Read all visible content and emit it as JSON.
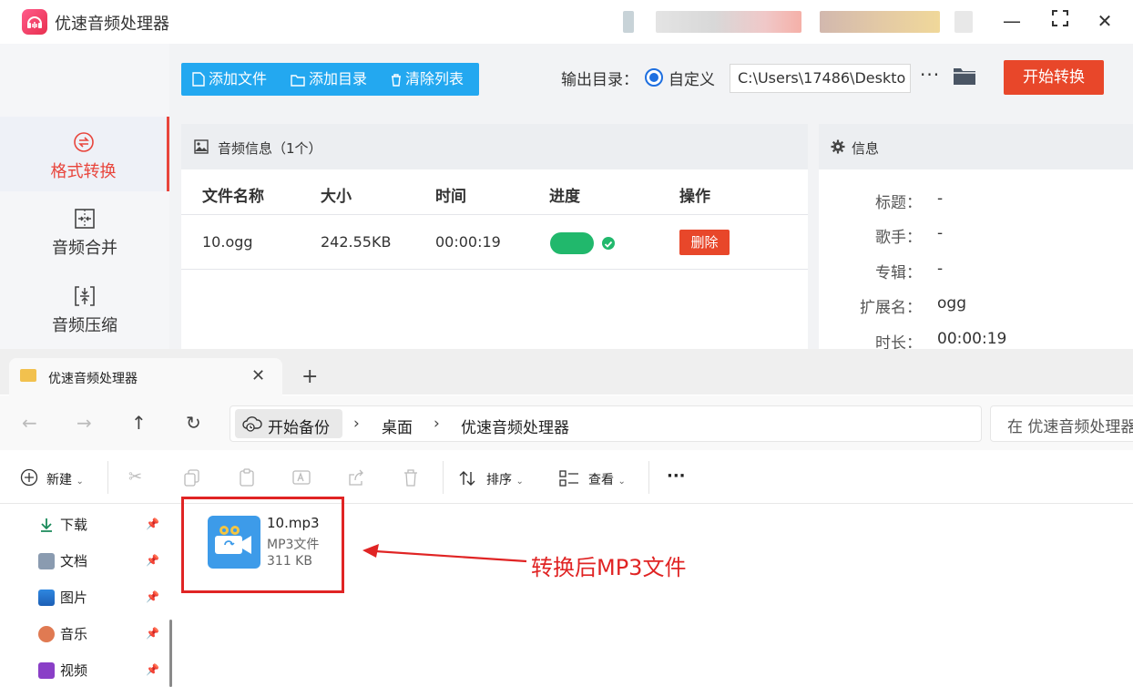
{
  "app": {
    "title": "优速音频处理器",
    "window_controls": {
      "minimize": "—",
      "maximize": "⛶",
      "close": "✕"
    }
  },
  "sidebar": {
    "items": [
      {
        "label": "格式转换",
        "icon": "convert-icon",
        "active": true
      },
      {
        "label": "音频合并",
        "icon": "merge-icon",
        "active": false
      },
      {
        "label": "音频压缩",
        "icon": "compress-icon",
        "active": false
      }
    ]
  },
  "toolbar": {
    "add_file": "添加文件",
    "add_dir": "添加目录",
    "clear_list": "清除列表",
    "output_label": "输出目录：",
    "radio_label": "自定义",
    "output_path": "C:\\Users\\17486\\Deskto",
    "more": "···",
    "start": "开始转换"
  },
  "file_panel": {
    "header": "音频信息（1个）",
    "columns": [
      "文件名称",
      "大小",
      "时间",
      "进度",
      "操作"
    ],
    "rows": [
      {
        "name": "10.ogg",
        "size": "242.55KB",
        "time": "00:00:19",
        "progress": 1.0,
        "action": "删除"
      }
    ]
  },
  "info_panel": {
    "header": "信息",
    "fields": [
      {
        "key": "标题：",
        "value": "-"
      },
      {
        "key": "歌手：",
        "value": "-"
      },
      {
        "key": "专辑：",
        "value": "-"
      },
      {
        "key": "扩展名：",
        "value": "ogg"
      },
      {
        "key": "时长：",
        "value": "00:00:19"
      }
    ]
  },
  "explorer": {
    "tab_title": "优速音频处理器",
    "breadcrumbs": [
      "开始备份",
      "桌面",
      "优速音频处理器"
    ],
    "search_placeholder": "在 优速音频处理器",
    "commands": {
      "new": "新建",
      "sort": "排序",
      "view": "查看",
      "more": "···"
    },
    "nav_items": [
      "下载",
      "文档",
      "图片",
      "音乐",
      "视频"
    ],
    "file": {
      "name": "10.mp3",
      "type": "MP3文件",
      "size": "311 KB"
    },
    "annotation": "转换后MP3文件"
  },
  "colors": {
    "accent_red": "#e8472a",
    "toolbar_blue": "#23a8f0",
    "progress_green": "#21b86c",
    "annotation_red": "#e02424"
  }
}
